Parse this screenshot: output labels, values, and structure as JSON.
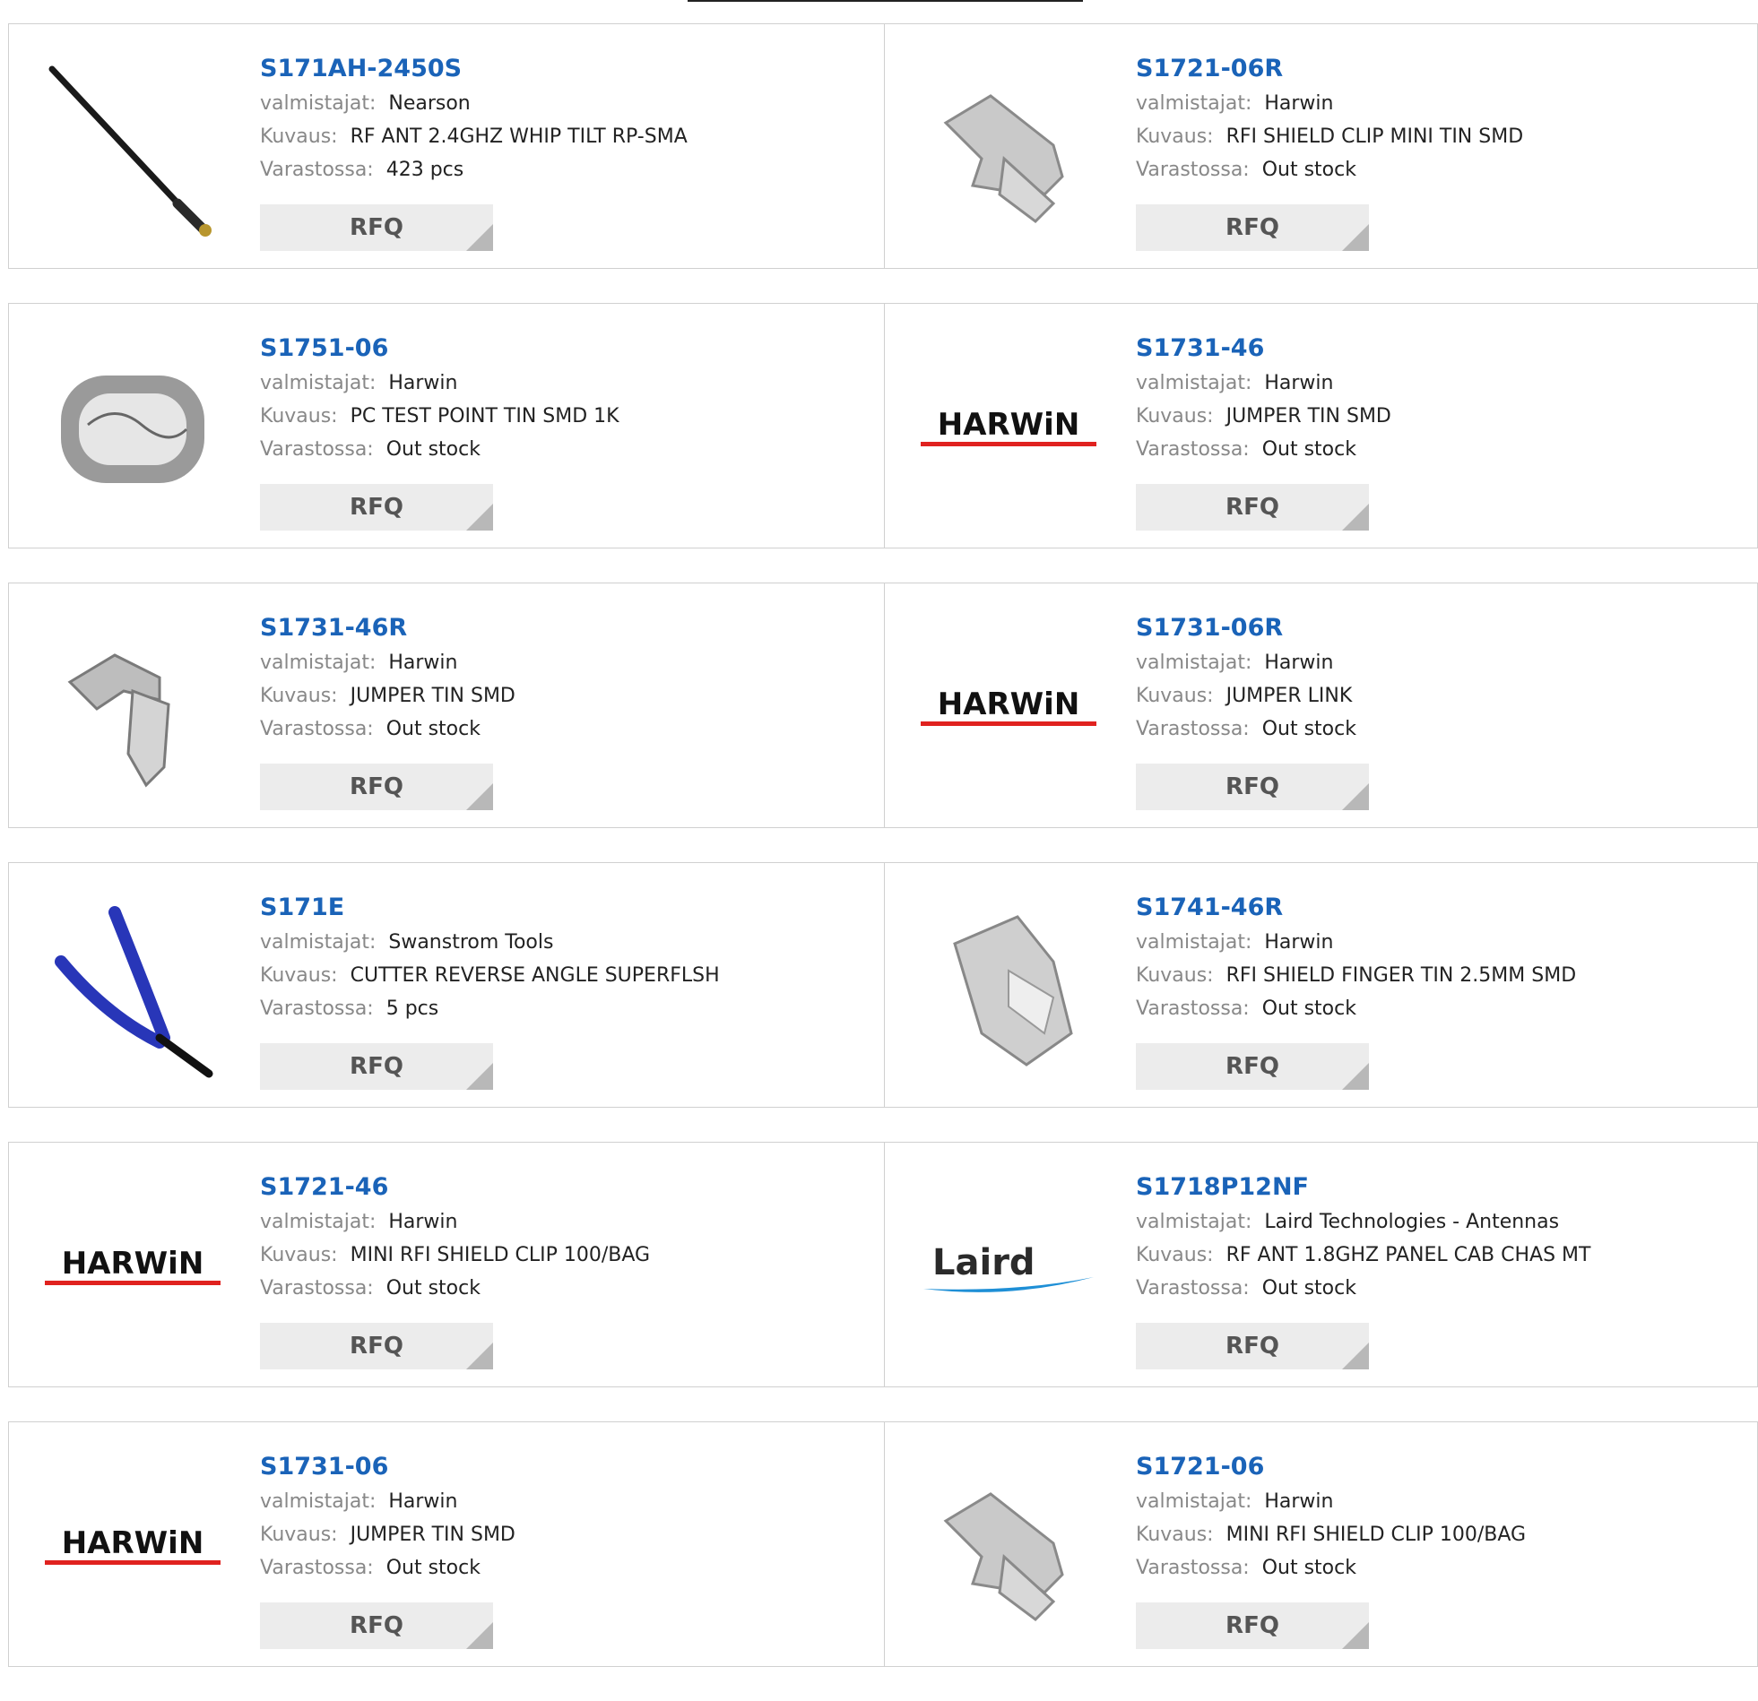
{
  "labels": {
    "manufacturer": "valmistajat:",
    "description": "Kuvaus:",
    "stock": "Varastossa:",
    "rfq": "RFQ"
  },
  "brand_colors": {
    "link": "#1a63b8",
    "harwin_red": "#e0221f",
    "laird_blue": "#1e8fd6"
  },
  "products": [
    {
      "part": "S171AH-2450S",
      "manufacturer": "Nearson",
      "description": "RF ANT 2.4GHZ WHIP TILT RP-SMA",
      "stock": "423 pcs",
      "image": "antenna-icon"
    },
    {
      "part": "S1721-06R",
      "manufacturer": "Harwin",
      "description": "RFI SHIELD CLIP MINI TIN SMD",
      "stock": "Out stock",
      "image": "shield-clip-icon"
    },
    {
      "part": "S1751-06",
      "manufacturer": "Harwin",
      "description": "PC TEST POINT TIN SMD 1K",
      "stock": "Out stock",
      "image": "test-point-icon"
    },
    {
      "part": "S1731-46",
      "manufacturer": "Harwin",
      "description": "JUMPER TIN SMD",
      "stock": "Out stock",
      "image": "harwin-logo",
      "logo_text": "HARWiN"
    },
    {
      "part": "S1731-46R",
      "manufacturer": "Harwin",
      "description": "JUMPER TIN SMD",
      "stock": "Out stock",
      "image": "jumper-icon"
    },
    {
      "part": "S1731-06R",
      "manufacturer": "Harwin",
      "description": "JUMPER LINK",
      "stock": "Out stock",
      "image": "harwin-logo",
      "logo_text": "HARWiN"
    },
    {
      "part": "S171E",
      "manufacturer": "Swanstrom Tools",
      "description": "CUTTER REVERSE ANGLE SUPERFLSH",
      "stock": "5 pcs",
      "image": "cutter-icon"
    },
    {
      "part": "S1741-46R",
      "manufacturer": "Harwin",
      "description": "RFI SHIELD FINGER TIN 2.5MM SMD",
      "stock": "Out stock",
      "image": "shield-finger-icon"
    },
    {
      "part": "S1721-46",
      "manufacturer": "Harwin",
      "description": "MINI RFI SHIELD CLIP 100/BAG",
      "stock": "Out stock",
      "image": "harwin-logo",
      "logo_text": "HARWiN"
    },
    {
      "part": "S1718P12NF",
      "manufacturer": "Laird Technologies - Antennas",
      "description": "RF ANT 1.8GHZ PANEL CAB CHAS MT",
      "stock": "Out stock",
      "image": "laird-logo",
      "logo_text": "Laird"
    },
    {
      "part": "S1731-06",
      "manufacturer": "Harwin",
      "description": "JUMPER TIN SMD",
      "stock": "Out stock",
      "image": "harwin-logo",
      "logo_text": "HARWiN"
    },
    {
      "part": "S1721-06",
      "manufacturer": "Harwin",
      "description": "MINI RFI SHIELD CLIP 100/BAG",
      "stock": "Out stock",
      "image": "shield-clip-icon"
    }
  ]
}
